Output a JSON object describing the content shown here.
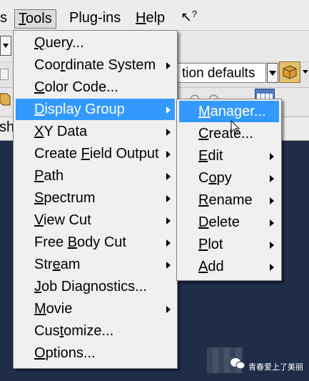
{
  "menubar": {
    "partial_item": "s",
    "items": [
      {
        "pre": "",
        "u": "T",
        "post": "ools"
      },
      {
        "pre": "Plug-",
        "u": "",
        "post": "ins"
      },
      {
        "pre": "",
        "u": "H",
        "post": "elp"
      }
    ],
    "help_cursor_icon": "?"
  },
  "toolbar": {
    "display_defaults": "tion defaults",
    "left_text": "sh",
    "undo_icon": "↶",
    "redo_icon": "↷"
  },
  "tools_menu": {
    "items": [
      {
        "pre": "",
        "u": "Q",
        "post": "uery...",
        "submenu": false,
        "highlighted": false
      },
      {
        "pre": "Coo",
        "u": "r",
        "post": "dinate System",
        "submenu": true,
        "highlighted": false
      },
      {
        "pre": "",
        "u": "C",
        "post": "olor Code...",
        "submenu": false,
        "highlighted": false
      },
      {
        "pre": "",
        "u": "D",
        "post": "isplay Group",
        "submenu": true,
        "highlighted": true
      },
      {
        "pre": "",
        "u": "X",
        "post": "Y Data",
        "submenu": true,
        "highlighted": false
      },
      {
        "pre": "Create ",
        "u": "F",
        "post": "ield Output",
        "submenu": true,
        "highlighted": false
      },
      {
        "pre": "",
        "u": "P",
        "post": "ath",
        "submenu": true,
        "highlighted": false
      },
      {
        "pre": "",
        "u": "S",
        "post": "pectrum",
        "submenu": true,
        "highlighted": false
      },
      {
        "pre": "",
        "u": "V",
        "post": "iew Cut",
        "submenu": true,
        "highlighted": false
      },
      {
        "pre": "Free ",
        "u": "B",
        "post": "ody Cut",
        "submenu": true,
        "highlighted": false
      },
      {
        "pre": "Str",
        "u": "e",
        "post": "am",
        "submenu": true,
        "highlighted": false
      },
      {
        "pre": "",
        "u": "J",
        "post": "ob Diagnostics...",
        "submenu": false,
        "highlighted": false
      },
      {
        "pre": "",
        "u": "M",
        "post": "ovie",
        "submenu": true,
        "highlighted": false
      },
      {
        "pre": "Cus",
        "u": "t",
        "post": "omize...",
        "submenu": false,
        "highlighted": false
      },
      {
        "pre": "",
        "u": "O",
        "post": "ptions...",
        "submenu": false,
        "highlighted": false
      }
    ]
  },
  "display_group_submenu": {
    "items": [
      {
        "pre": "",
        "u": "M",
        "post": "anager...",
        "submenu": false,
        "highlighted": true
      },
      {
        "pre": "",
        "u": "C",
        "post": "reate...",
        "submenu": false,
        "highlighted": false
      },
      {
        "pre": "",
        "u": "E",
        "post": "dit",
        "submenu": true,
        "highlighted": false
      },
      {
        "pre": "C",
        "u": "o",
        "post": "py",
        "submenu": true,
        "highlighted": false
      },
      {
        "pre": "",
        "u": "R",
        "post": "ename",
        "submenu": true,
        "highlighted": false
      },
      {
        "pre": "",
        "u": "D",
        "post": "elete",
        "submenu": true,
        "highlighted": false
      },
      {
        "pre": "",
        "u": "P",
        "post": "lot",
        "submenu": true,
        "highlighted": false
      },
      {
        "pre": "",
        "u": "A",
        "post": "dd",
        "submenu": true,
        "highlighted": false
      }
    ]
  },
  "watermark": {
    "text": "青春爱上了美丽",
    "logo_icon": "wechat-icon"
  },
  "colors": {
    "highlight": "#3399ff",
    "menu_bg": "#f0f0f0",
    "viewport_bg": "#1f2d48"
  }
}
